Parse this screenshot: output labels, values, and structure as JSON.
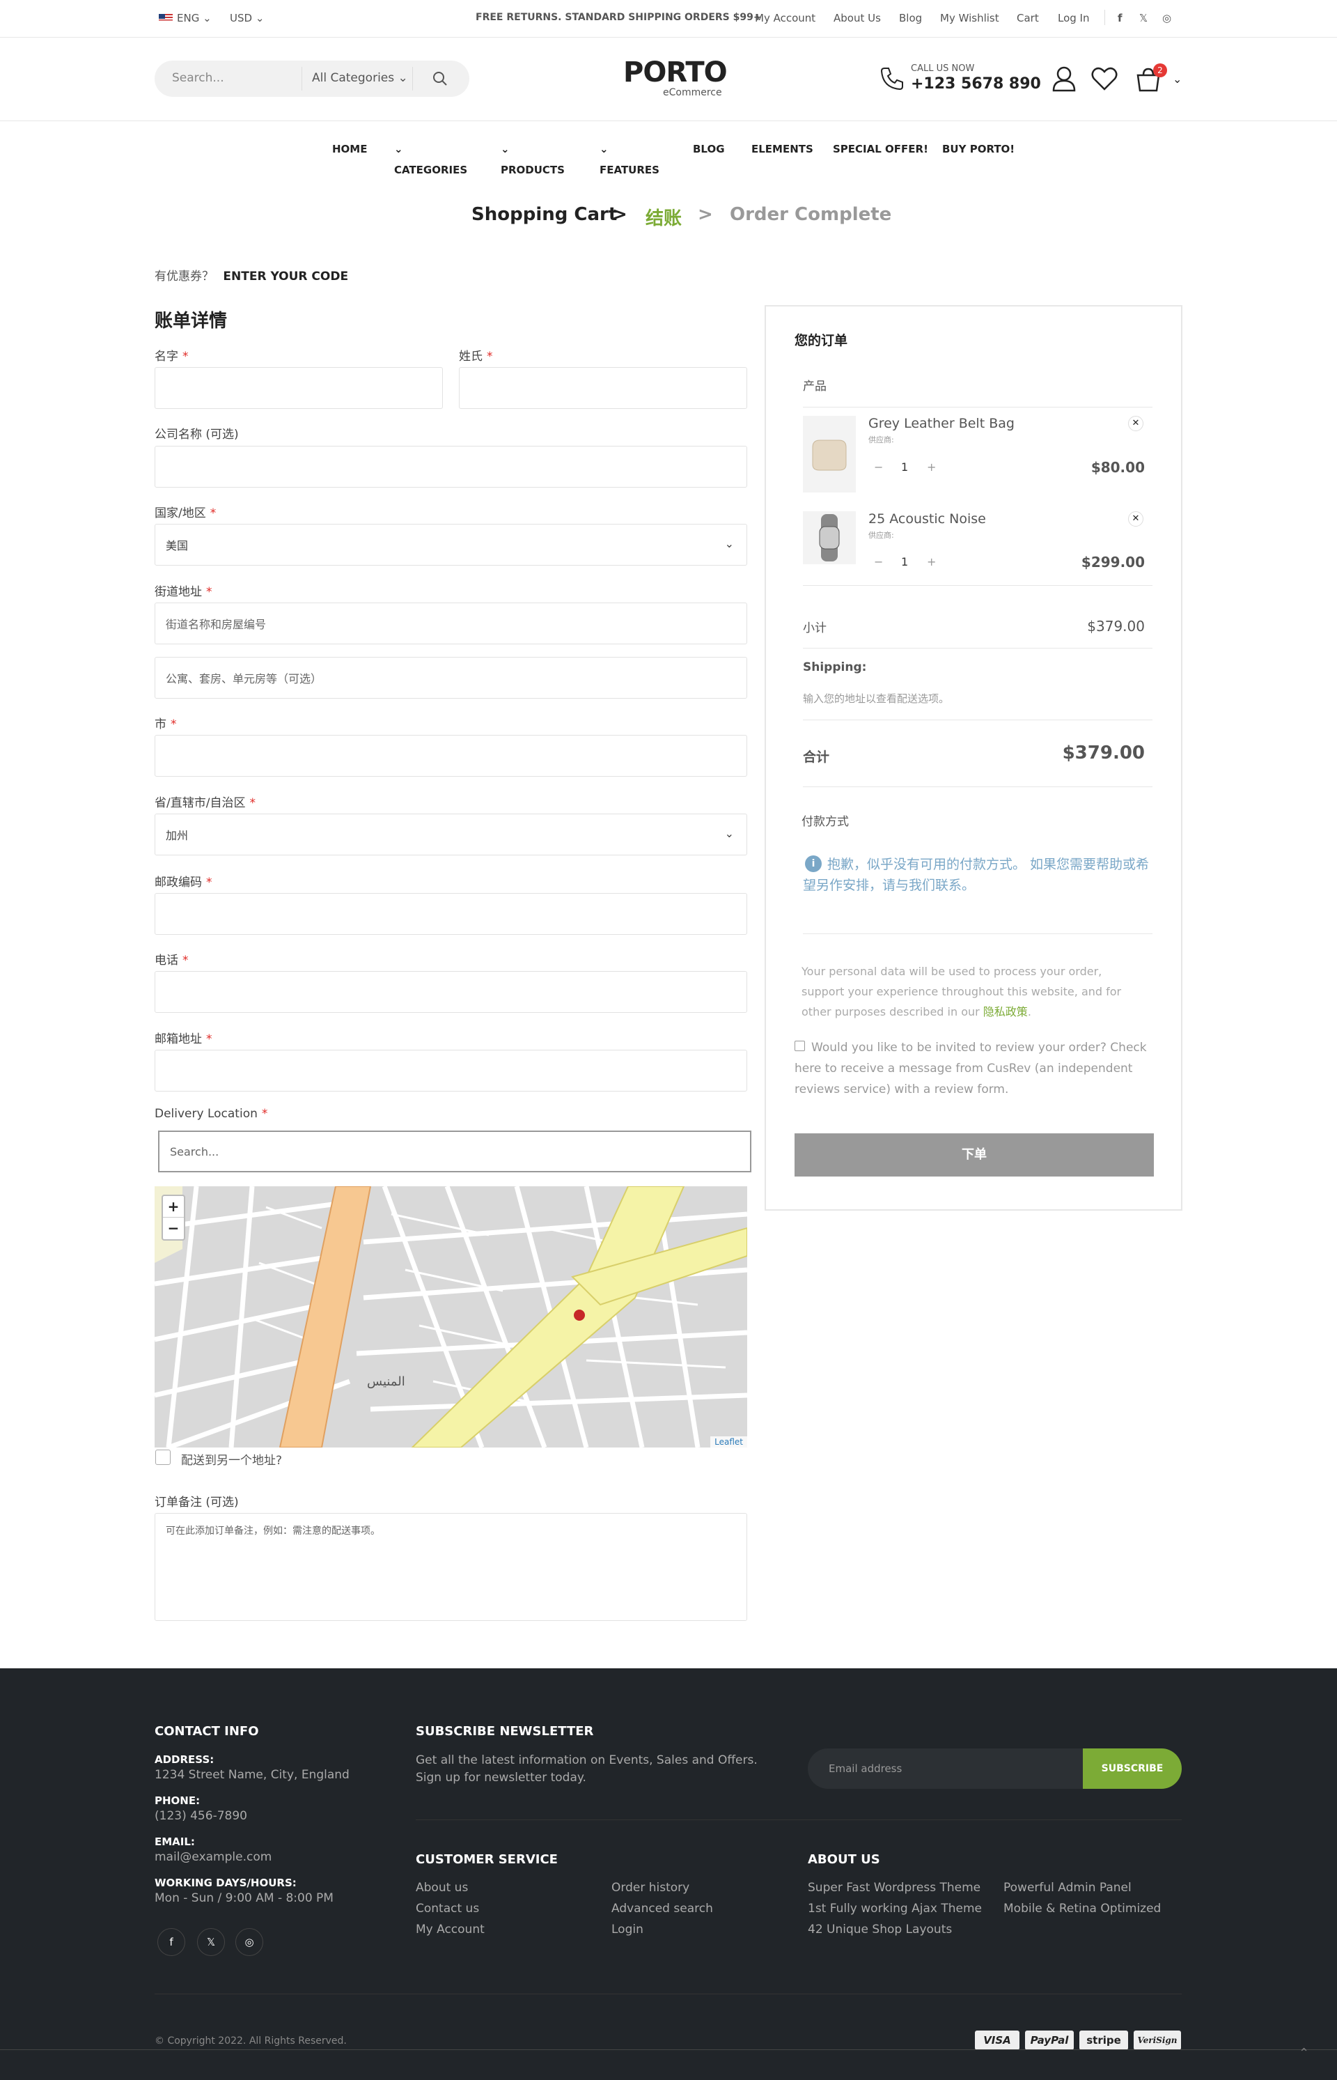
{
  "topbar": {
    "language": "ENG",
    "currency": "USD",
    "promo": "FREE RETURNS. STANDARD SHIPPING ORDERS $99+",
    "links": [
      "My Account",
      "About Us",
      "Blog",
      "My Wishlist",
      "Cart",
      "Log In"
    ]
  },
  "header": {
    "search_placeholder": "Search...",
    "category": "All Categories",
    "logo_main": "PORTO",
    "logo_sub": "eCommerce",
    "call_label": "CALL US NOW",
    "phone": "+123 5678 890",
    "cart_count": "2"
  },
  "nav": [
    "HOME",
    "CATEGORIES",
    "PRODUCTS",
    "FEATURES",
    "BLOG",
    "ELEMENTS",
    "SPECIAL OFFER!",
    "BUY PORTO!"
  ],
  "steps": {
    "cart": "Shopping Cart",
    "checkout": "结账",
    "complete": "Order Complete"
  },
  "coupon": {
    "question": "有优惠券？",
    "link": "ENTER YOUR CODE"
  },
  "billing": {
    "title": "账单详情",
    "first_name": "名字",
    "last_name": "姓氏",
    "company": "公司名称 (可选)",
    "country": "国家/地区",
    "country_value": "美国",
    "street": "街道地址",
    "street_placeholder": "街道名称和房屋编号",
    "street2_placeholder": "公寓、套房、单元房等（可选）",
    "city": "市",
    "state": "省/直辖市/自治区",
    "state_value": "加州",
    "postcode": "邮政编码",
    "phone": "电话",
    "email": "邮箱地址",
    "delivery_location": "Delivery Location",
    "map_search_placeholder": "Search...",
    "map_zoom_in": "+",
    "map_zoom_out": "−",
    "map_attribution": "Leaflet",
    "map_area_label": "المنيس",
    "ship_different": "配送到另一个地址?",
    "notes_label": "订单备注 (可选)",
    "notes_placeholder": "可在此添加订单备注，例如：需注意的配送事项。"
  },
  "order": {
    "title": "您的订单",
    "product_header": "产品",
    "items": [
      {
        "name": "Grey Leather Belt Bag",
        "vendor": "供应商:",
        "qty": "1",
        "price": "$80.00"
      },
      {
        "name": "25 Acoustic Noise",
        "vendor": "供应商:",
        "qty": "1",
        "price": "$299.00"
      }
    ],
    "subtotal_label": "小计",
    "subtotal": "$379.00",
    "shipping_label": "Shipping:",
    "shipping_note": "输入您的地址以查看配送选项。",
    "total_label": "合计",
    "total": "$379.00",
    "payment_label": "付款方式",
    "payment_notice": "抱歉，似乎没有可用的付款方式。 如果您需要帮助或希望另作安排，请与我们联系。",
    "privacy_lines": [
      "Your personal data will be used to process your order,",
      "support your experience throughout this website, and for",
      "other purposes described in our "
    ],
    "privacy_link": "隐私政策",
    "review_lines": [
      "Would you like to be invited to review your order? Check",
      "here to receive a message from CusRev (an independent",
      "reviews service) with a review form."
    ],
    "place_order": "下单"
  },
  "footer": {
    "contact_title": "CONTACT INFO",
    "address_label": "ADDRESS:",
    "address": "1234 Street Name, City, England",
    "phone_label": "PHONE:",
    "phone": "(123) 456-7890",
    "email_label": "EMAIL:",
    "email": "mail@example.com",
    "hours_label": "WORKING DAYS/HOURS:",
    "hours": "Mon - Sun / 9:00 AM - 8:00 PM",
    "newsletter_title": "SUBSCRIBE NEWSLETTER",
    "newsletter_text": [
      "Get all the latest information on Events, Sales and Offers.",
      "Sign up for newsletter today."
    ],
    "email_placeholder": "Email address",
    "subscribe": "SUBSCRIBE",
    "customer_title": "CUSTOMER SERVICE",
    "customer_links": [
      "About us",
      "Contact us",
      "My Account",
      "Order history",
      "Advanced search",
      "Login"
    ],
    "about_title": "ABOUT US",
    "about_links": [
      "Super Fast Wordpress Theme",
      "1st Fully working Ajax Theme",
      "42 Unique Shop Layouts",
      "Powerful Admin Panel",
      "Mobile & Retina Optimized"
    ],
    "copyright": "© Copyright 2022. All Rights Reserved.",
    "payments": [
      "VISA",
      "PayPal",
      "stripe",
      "VeriSign"
    ]
  },
  "colors": {
    "accent": "#7cab36",
    "dark": "#212529",
    "button_grey": "#999999",
    "badge": "#e53935"
  }
}
